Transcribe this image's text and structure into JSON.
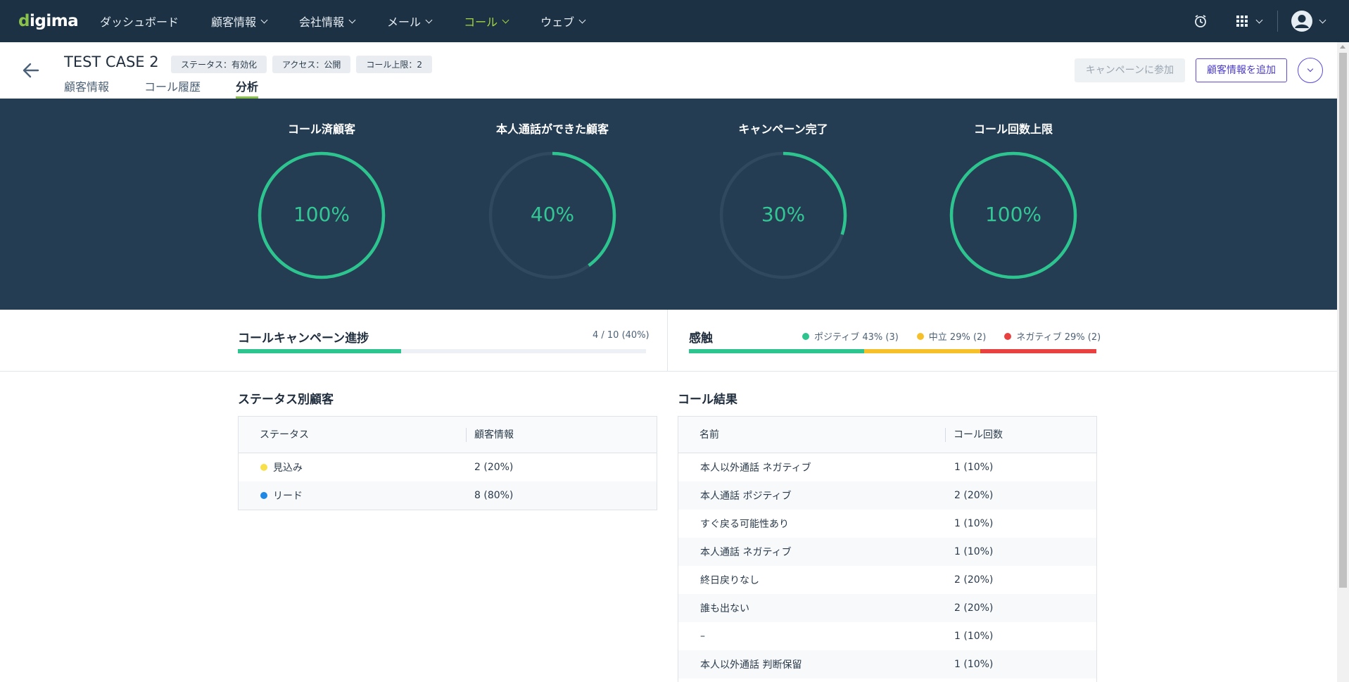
{
  "topnav": {
    "logo": "digima",
    "items": [
      {
        "label": "ダッシュボード",
        "has_caret": false,
        "active": false
      },
      {
        "label": "顧客情報",
        "has_caret": true,
        "active": false
      },
      {
        "label": "会社情報",
        "has_caret": true,
        "active": false
      },
      {
        "label": "メール",
        "has_caret": true,
        "active": false
      },
      {
        "label": "コール",
        "has_caret": true,
        "active": true
      },
      {
        "label": "ウェブ",
        "has_caret": true,
        "active": false
      }
    ],
    "icons": [
      "alarm-clock-icon",
      "apps-grid-icon",
      "user-avatar-icon"
    ]
  },
  "header": {
    "title": "TEST CASE 2",
    "badges": [
      "ステータス：有効化",
      "アクセス：公開",
      "コール上限：2"
    ],
    "tabs": [
      {
        "label": "顧客情報",
        "active": false
      },
      {
        "label": "コール履歴",
        "active": false
      },
      {
        "label": "分析",
        "active": true
      }
    ],
    "join_campaign_label": "キャンペーンに参加",
    "add_customer_label": "顧客情報を追加"
  },
  "stats": [
    {
      "label": "コール済顧客",
      "value": "100%",
      "fraction": 1.0
    },
    {
      "label": "本人通話ができた顧客",
      "value": "40%",
      "fraction": 0.4
    },
    {
      "label": "キャンペーン完了",
      "value": "30%",
      "fraction": 0.3
    },
    {
      "label": "コール回数上限",
      "value": "100%",
      "fraction": 1.0
    }
  ],
  "progress": {
    "title": "コールキャンペーン進捗",
    "count": "4 / 10 (40%)",
    "fraction": 0.4
  },
  "sentiment": {
    "title": "感触",
    "items": [
      {
        "label": "ポジティブ 43% (3)",
        "color": "#2ec48f",
        "fraction": 0.43
      },
      {
        "label": "中立 29% (2)",
        "color": "#f5c02a",
        "fraction": 0.285
      },
      {
        "label": "ネガティブ 29% (2)",
        "color": "#e8413f",
        "fraction": 0.285
      }
    ]
  },
  "status_table": {
    "title": "ステータス別顧客",
    "headers": [
      "ステータス",
      "顧客情報"
    ],
    "rows": [
      {
        "status": "見込み",
        "color": "#f7e04a",
        "value": "2 (20%)"
      },
      {
        "status": "リード",
        "color": "#1e88e5",
        "value": "8 (80%)"
      }
    ]
  },
  "call_table": {
    "title": "コール結果",
    "headers": [
      "名前",
      "コール回数"
    ],
    "rows": [
      {
        "name": "本人以外通話 ネガティブ",
        "value": "1 (10%)"
      },
      {
        "name": "本人通話 ポジティブ",
        "value": "2 (20%)"
      },
      {
        "name": "すぐ戻る可能性あり",
        "value": "1 (10%)"
      },
      {
        "name": "本人通話 ネガティブ",
        "value": "1 (10%)"
      },
      {
        "name": "終日戻りなし",
        "value": "2 (20%)"
      },
      {
        "name": "誰も出ない",
        "value": "2 (20%)"
      },
      {
        "name": "–",
        "value": "1 (10%)"
      },
      {
        "name": "本人以外通話 判断保留",
        "value": "1 (10%)"
      }
    ]
  },
  "colors": {
    "nav_bg": "#1c3144",
    "stats_bg": "#243d52",
    "accent_green": "#2ec48f",
    "nav_active": "#a5d63f"
  }
}
